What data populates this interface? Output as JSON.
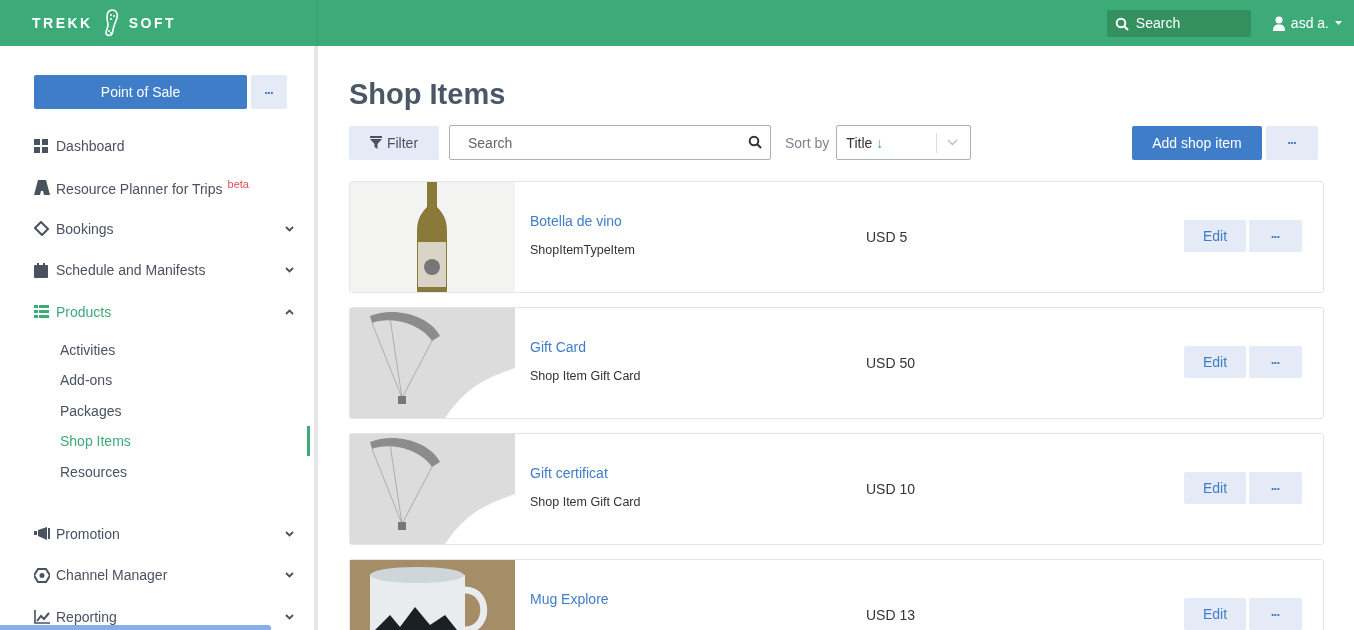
{
  "header": {
    "logo_left": "TREKK",
    "logo_right": "SOFT",
    "search": {
      "placeholder": "Search"
    },
    "user": "asd a."
  },
  "sidebar": {
    "primary_button": "Point of Sale",
    "more_button": "•••",
    "items": [
      {
        "label": "Dashboard",
        "kind": "grid",
        "selected": false
      },
      {
        "label": "Resource Planner for Trips",
        "badge": "beta",
        "kind": "road",
        "selected": false
      },
      {
        "label": "Bookings",
        "kind": "ticket",
        "selected": false,
        "expanded": false
      },
      {
        "label": "Schedule and Manifests",
        "kind": "calendar",
        "selected": false,
        "expanded": false
      },
      {
        "label": "Products",
        "kind": "list",
        "selected": true,
        "expanded": true,
        "children": [
          {
            "label": "Activities",
            "selected": false
          },
          {
            "label": "Add-ons",
            "selected": false
          },
          {
            "label": "Packages",
            "selected": false
          },
          {
            "label": "Shop Items",
            "selected": true
          },
          {
            "label": "Resources",
            "selected": false
          }
        ]
      },
      {
        "label": "Promotion",
        "kind": "megaphone",
        "selected": false,
        "expanded": false
      },
      {
        "label": "Channel Manager",
        "kind": "hexagon",
        "selected": false,
        "expanded": false
      },
      {
        "label": "Reporting",
        "kind": "chart",
        "selected": false,
        "expanded": false
      }
    ]
  },
  "page": {
    "title": "Shop Items",
    "filter_button": "Filter",
    "search": {
      "placeholder": "Search"
    },
    "sort_label": "Sort by",
    "sort": {
      "value": "Title",
      "arrow": "↓"
    },
    "add_button": "Add shop item",
    "more_button": "•••"
  },
  "items": [
    {
      "title": "Botella de vino",
      "type": "ShopItemTypeItem",
      "price": "USD 5",
      "kind": "bottle",
      "edit": "Edit",
      "more": "•••"
    },
    {
      "title": "Gift Card",
      "type": "Shop Item Gift Card",
      "price": "USD 50",
      "kind": "paraglider",
      "edit": "Edit",
      "more": "•••"
    },
    {
      "title": "Gift certificat",
      "type": "Shop Item Gift Card",
      "price": "USD 10",
      "kind": "paraglider",
      "edit": "Edit",
      "more": "•••"
    },
    {
      "title": "Mug Explore",
      "price": "USD 13",
      "kind": "mug",
      "edit": "Edit",
      "more": "•••"
    }
  ]
}
